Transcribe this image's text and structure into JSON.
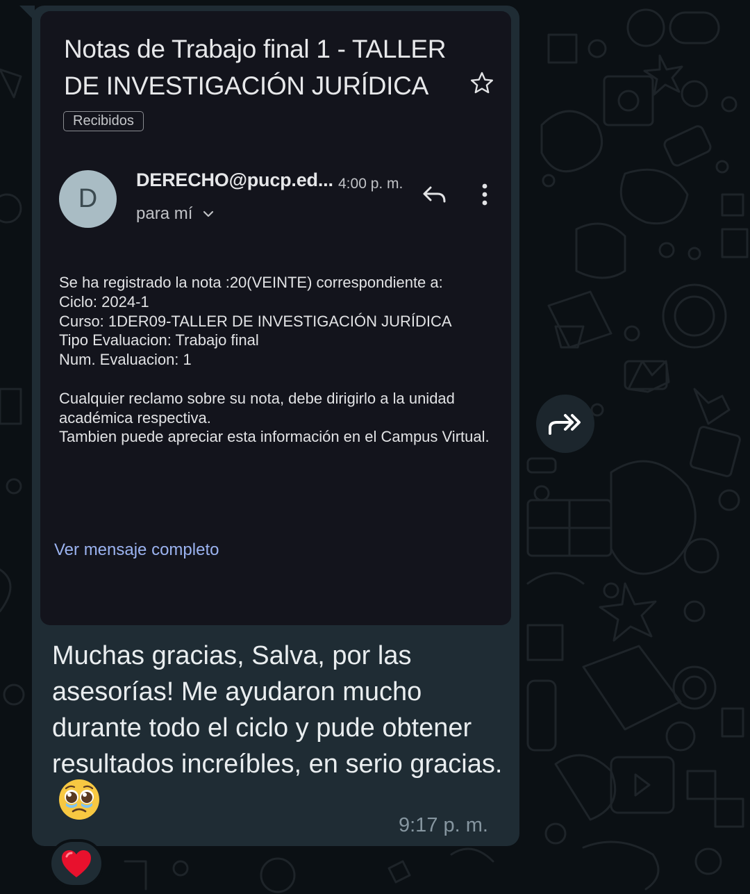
{
  "email": {
    "subject": "Notas de Trabajo final 1 - TALLER DE INVESTIGACIÓN JURÍDICA",
    "label": "Recibidos",
    "avatar_letter": "D",
    "sender": "DERECHO@pucp.ed...",
    "time": "4:00 p. m.",
    "recipient": "para mí",
    "body": [
      "Se ha registrado la nota :20(VEINTE) correspondiente a:",
      "Ciclo: 2024-1",
      "Curso: 1DER09-TALLER DE INVESTIGACIÓN JURÍDICA",
      "Tipo Evaluacion: Trabajo final",
      "Num. Evaluacion: 1",
      "Cualquier reclamo sobre su nota, debe dirigirlo a la unidad académica respectiva.",
      "Tambien puede apreciar esta información en el Campus Virtual."
    ],
    "view_full": "Ver mensaje completo"
  },
  "message": {
    "text": "Muchas gracias, Salva, por las asesorías! Me ayudaron mucho durante todo el ciclo y pude obtener resultados increíbles, en serio gracias.",
    "emoji_icon": "pleading-face-icon",
    "time": "9:17 p. m."
  },
  "reaction": {
    "icon": "red-heart-icon",
    "color": "#e8112d"
  },
  "colors": {
    "background": "#0b1014",
    "bubble": "#1f2c34",
    "email_card": "#13141c",
    "link": "#9bb3f0"
  }
}
